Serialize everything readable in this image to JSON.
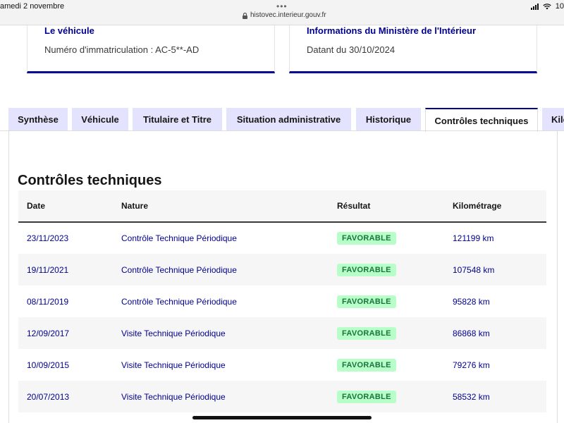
{
  "statusbar": {
    "date": "amedi 2 novembre",
    "dots": "•••",
    "url": "histovec.interieur.gouv.fr",
    "battery": "10"
  },
  "cards": {
    "vehicle": {
      "title": "Le véhicule",
      "text": "Numéro d'immatriculation : AC-5**-AD"
    },
    "ministry": {
      "title": "Informations du Ministère de l'Intérieur",
      "text": "Datant du 30/10/2024"
    }
  },
  "tabs": [
    {
      "label": "Synthèse"
    },
    {
      "label": "Véhicule"
    },
    {
      "label": "Titulaire et Titre"
    },
    {
      "label": "Situation administrative"
    },
    {
      "label": "Historique"
    },
    {
      "label": "Contrôles techniques"
    },
    {
      "label": "Kilo"
    }
  ],
  "section": {
    "title": "Contrôles techniques",
    "columns": [
      "Date",
      "Nature",
      "Résultat",
      "Kilométrage"
    ],
    "rows": [
      {
        "date": "23/11/2023",
        "nature": "Contrôle Technique Périodique",
        "result": "FAVORABLE",
        "km": "121199 km"
      },
      {
        "date": "19/11/2021",
        "nature": "Contrôle Technique Périodique",
        "result": "FAVORABLE",
        "km": "107548 km"
      },
      {
        "date": "08/11/2019",
        "nature": "Contrôle Technique Périodique",
        "result": "FAVORABLE",
        "km": "95828 km"
      },
      {
        "date": "12/09/2017",
        "nature": "Visite Technique Périodique",
        "result": "FAVORABLE",
        "km": "86868 km"
      },
      {
        "date": "10/09/2015",
        "nature": "Visite Technique Périodique",
        "result": "FAVORABLE",
        "km": "79276 km"
      },
      {
        "date": "20/07/2013",
        "nature": "Visite Technique Périodique",
        "result": "FAVORABLE",
        "km": "58532 km"
      }
    ]
  },
  "colors": {
    "accent": "#000091",
    "badge_bg": "#b8fec9",
    "badge_text": "#18753c",
    "tab_bg": "#e3e3fd"
  }
}
